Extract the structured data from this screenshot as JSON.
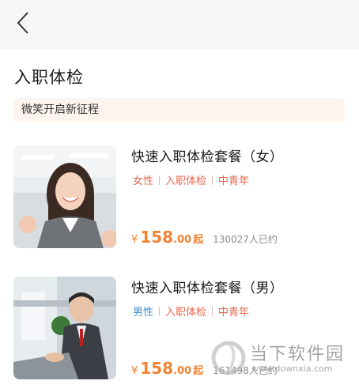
{
  "header": {
    "back_icon": "chevron-left-icon"
  },
  "page": {
    "title": "入职体检",
    "banner": "微笑开启新征程"
  },
  "packages": [
    {
      "title": "快速入职体检套餐（女）",
      "tags": [
        "女性",
        "入职体检",
        "中青年"
      ],
      "currency": "¥",
      "price_int": "158",
      "price_dec": ".00",
      "price_suffix": "起",
      "booked": "130027人已约"
    },
    {
      "title": "快速入职体检套餐（男）",
      "tags": [
        "男性",
        "入职体检",
        "中青年"
      ],
      "currency": "¥",
      "price_int": "158",
      "price_dec": ".00",
      "price_suffix": "起",
      "booked": "161498人已约"
    }
  ],
  "watermark": {
    "title": "当下软件园",
    "url": "www.downxia.com"
  },
  "colors": {
    "accent_orange": "#f08232",
    "tag_red": "#e8654a",
    "tag_blue": "#3b8fd0",
    "banner_bg": "#fdf4ee"
  }
}
